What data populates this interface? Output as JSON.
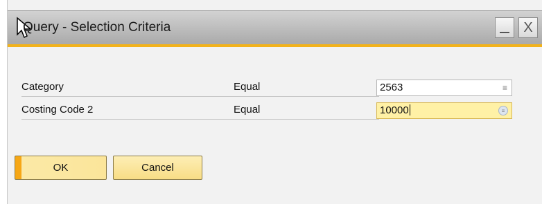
{
  "window": {
    "title": "Query - Selection Criteria",
    "minimize_symbol": "_",
    "close_symbol": "X"
  },
  "criteria": [
    {
      "label": "Category",
      "operator": "Equal",
      "value": "2563",
      "icon": "list-icon"
    },
    {
      "label": "Costing Code 2",
      "operator": "Equal",
      "value": "10000",
      "icon": "dropdown-circle-icon"
    }
  ],
  "buttons": {
    "ok_label": "OK",
    "cancel_label": "Cancel"
  },
  "colors": {
    "accent": "#f2b21b",
    "active_field": "#fff1a6",
    "button": "#fbe59a"
  }
}
